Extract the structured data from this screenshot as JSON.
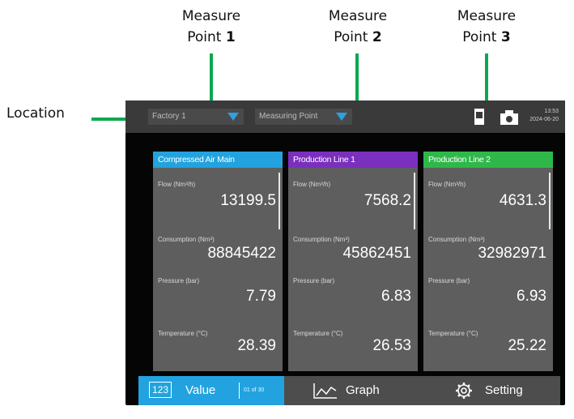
{
  "annotations": {
    "location": "Location",
    "mp1": {
      "line1": "Measure",
      "prefix": "Point ",
      "num": "1"
    },
    "mp2": {
      "line1": "Measure",
      "prefix": "Point ",
      "num": "2"
    },
    "mp3": {
      "line1": "Measure",
      "prefix": "Point ",
      "num": "3"
    },
    "line_color": "#0aa84f"
  },
  "topbar": {
    "location_select": "Factory 1",
    "measuring_point_select": "Measuring Point",
    "time": "13:53",
    "date": "2024-06-20"
  },
  "cards": [
    {
      "title": "Compressed Air Main",
      "color": "#22a3df",
      "flow_label": "Flow (Nm³/h)",
      "flow": "13199.5",
      "consumption_label": "Consumption (Nm³)",
      "consumption": "88845422",
      "pressure_label": "Pressure (bar)",
      "pressure": "7.79",
      "temperature_label": "Temperature (°C)",
      "temperature": "28.39"
    },
    {
      "title": "Production Line 1",
      "color": "#7b2fbe",
      "flow_label": "Flow (Nm³/h)",
      "flow": "7568.2",
      "consumption_label": "Consumption (Nm³)",
      "consumption": "45862451",
      "pressure_label": "Pressure (bar)",
      "pressure": "6.83",
      "temperature_label": "Temperature (°C)",
      "temperature": "26.53"
    },
    {
      "title": "Production Line 2",
      "color": "#2fb84a",
      "flow_label": "Flow (Nm³/h)",
      "flow": "4631.3",
      "consumption_label": "Consumption (Nm³)",
      "consumption": "32982971",
      "pressure_label": "Pressure (bar)",
      "pressure": "6.93",
      "temperature_label": "Temperature (°C)",
      "temperature": "25.22"
    }
  ],
  "tabs": {
    "value_icon": "123",
    "value_label": "Value",
    "page": "01 of 30",
    "graph_label": "Graph",
    "setting_label": "Setting"
  },
  "icons": [
    "document-icon",
    "camera-icon",
    "chevron-down-icon",
    "value-123-icon",
    "graph-icon",
    "gear-icon"
  ]
}
